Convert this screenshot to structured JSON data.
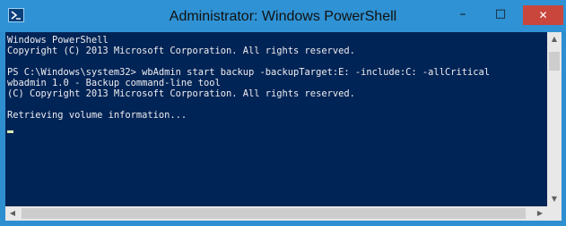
{
  "window": {
    "title": "Administrator: Windows PowerShell",
    "icon": "powershell-icon",
    "controls": {
      "minimize": "–",
      "maximize": "□",
      "close": "✕"
    }
  },
  "console": {
    "lines": [
      "Windows PowerShell",
      "Copyright (C) 2013 Microsoft Corporation. All rights reserved.",
      "",
      "PS C:\\Windows\\system32> wbAdmin start backup -backupTarget:E: -include:C: -allCritical",
      "wbadmin 1.0 - Backup command-line tool",
      "(C) Copyright 2013 Microsoft Corporation. All rights reserved.",
      "",
      "Retrieving volume information..."
    ]
  },
  "scrollbars": {
    "up": "▲",
    "down": "▼",
    "left": "◀",
    "right": "▶"
  },
  "colors": {
    "titlebar": "#2f92d4",
    "console_bg": "#012456",
    "console_text": "#eeedf0",
    "close_button": "#c9463d"
  }
}
